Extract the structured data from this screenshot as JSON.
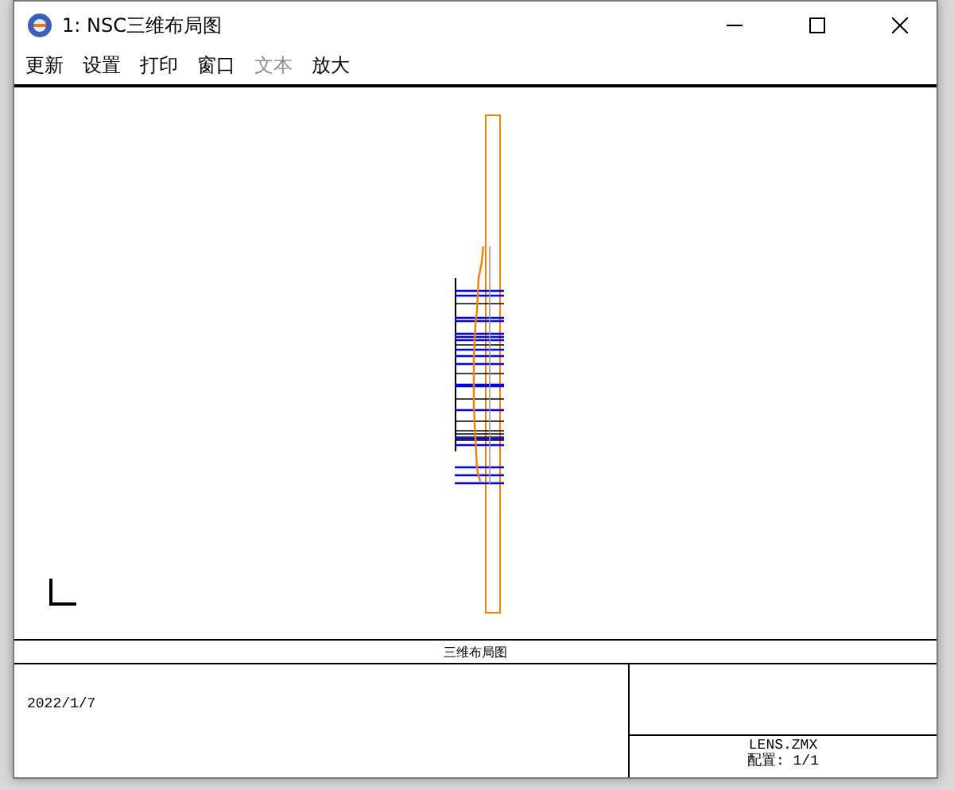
{
  "window": {
    "title": "1: NSC三维布局图"
  },
  "menu": [
    {
      "label": "更新",
      "disabled": false
    },
    {
      "label": "设置",
      "disabled": false
    },
    {
      "label": "打印",
      "disabled": false
    },
    {
      "label": "窗口",
      "disabled": false
    },
    {
      "label": "文本",
      "disabled": true
    },
    {
      "label": "放大",
      "disabled": false
    }
  ],
  "plot": {
    "title": "三维布局图",
    "date": "2022/1/7",
    "file": "LENS.ZMX",
    "configuration": "配置: 1/1"
  }
}
